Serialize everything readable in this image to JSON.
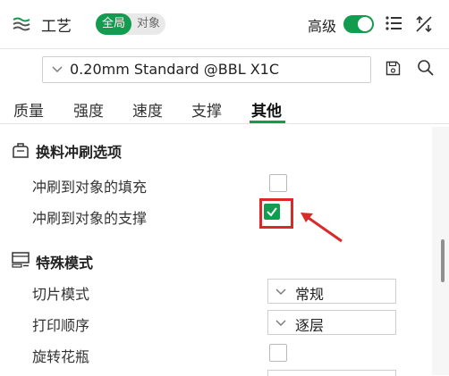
{
  "header": {
    "title": "工艺",
    "scope_global": "全局",
    "scope_object": "对象",
    "advanced_label": "高级"
  },
  "preset": {
    "value": "0.20mm Standard @BBL X1C"
  },
  "tabs": [
    {
      "label": "质量"
    },
    {
      "label": "强度"
    },
    {
      "label": "速度"
    },
    {
      "label": "支撑"
    },
    {
      "label": "其他",
      "active": true
    }
  ],
  "sections": {
    "flush": {
      "title": "换料冲刷选项",
      "rows": [
        {
          "label": "冲刷到对象的填充",
          "checked": false
        },
        {
          "label": "冲刷到对象的支撑",
          "checked": true
        }
      ]
    },
    "special": {
      "title": "特殊模式",
      "rows": [
        {
          "label": "切片模式",
          "value": "常规"
        },
        {
          "label": "打印顺序",
          "value": "逐层"
        },
        {
          "label": "旋转花瓶",
          "checked": false
        }
      ]
    }
  },
  "colors": {
    "accent": "#119c4f",
    "annotation": "#d92a2a"
  }
}
